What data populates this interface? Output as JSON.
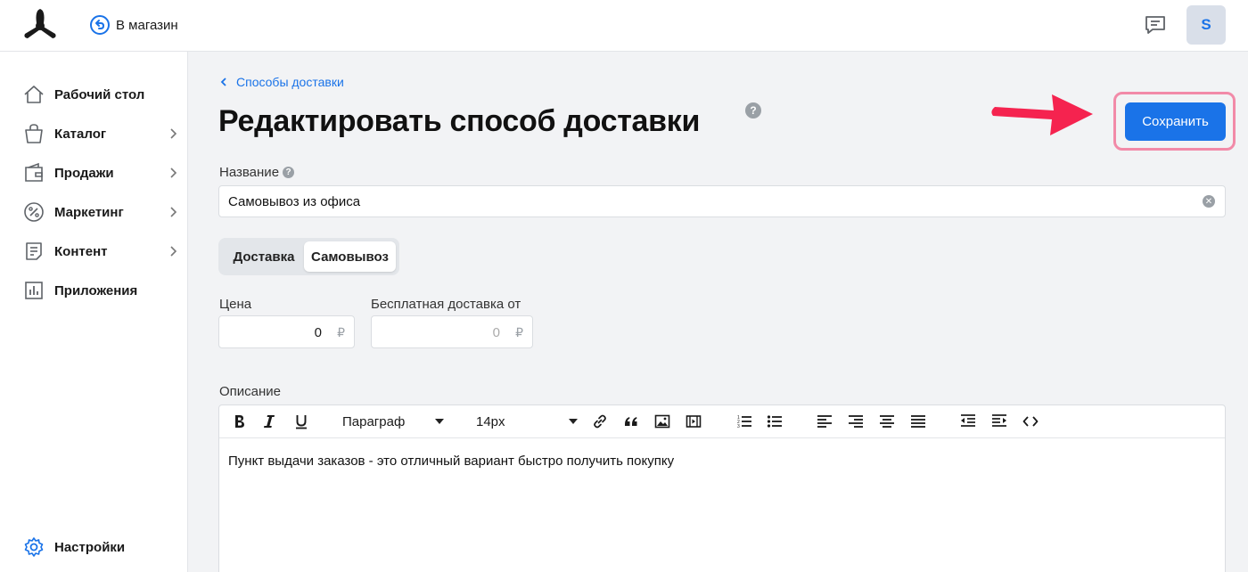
{
  "header": {
    "back_store_label": "В магазин",
    "avatar_initial": "S"
  },
  "sidebar": {
    "items": [
      {
        "label": "Рабочий стол",
        "icon": "home-icon",
        "has_submenu": false
      },
      {
        "label": "Каталог",
        "icon": "bag-icon",
        "has_submenu": true
      },
      {
        "label": "Продажи",
        "icon": "wallet-icon",
        "has_submenu": true
      },
      {
        "label": "Маркетинг",
        "icon": "percent-icon",
        "has_submenu": true
      },
      {
        "label": "Контент",
        "icon": "document-icon",
        "has_submenu": true
      },
      {
        "label": "Приложения",
        "icon": "chart-icon",
        "has_submenu": false
      }
    ],
    "settings_label": "Настройки"
  },
  "page": {
    "breadcrumb": "Способы доставки",
    "title": "Редактировать способ доставки",
    "save_label": "Сохранить"
  },
  "form": {
    "name_label": "Название",
    "name_value": "Самовывоз из офиса",
    "tabs": [
      "Доставка",
      "Самовывоз"
    ],
    "active_tab": "Самовывоз",
    "price_label": "Цена",
    "price_value": "0",
    "free_from_label": "Бесплатная доставка от",
    "free_from_placeholder": "0",
    "currency": "₽",
    "description_label": "Описание",
    "format_select": "Параграф",
    "size_select": "14px",
    "description_text": "Пункт выдачи заказов - это отличный вариант быстро получить покупку"
  },
  "colors": {
    "accent": "#1a73e8",
    "highlight_arrow": "#f5234f",
    "highlight_border": "#f28aa8"
  }
}
